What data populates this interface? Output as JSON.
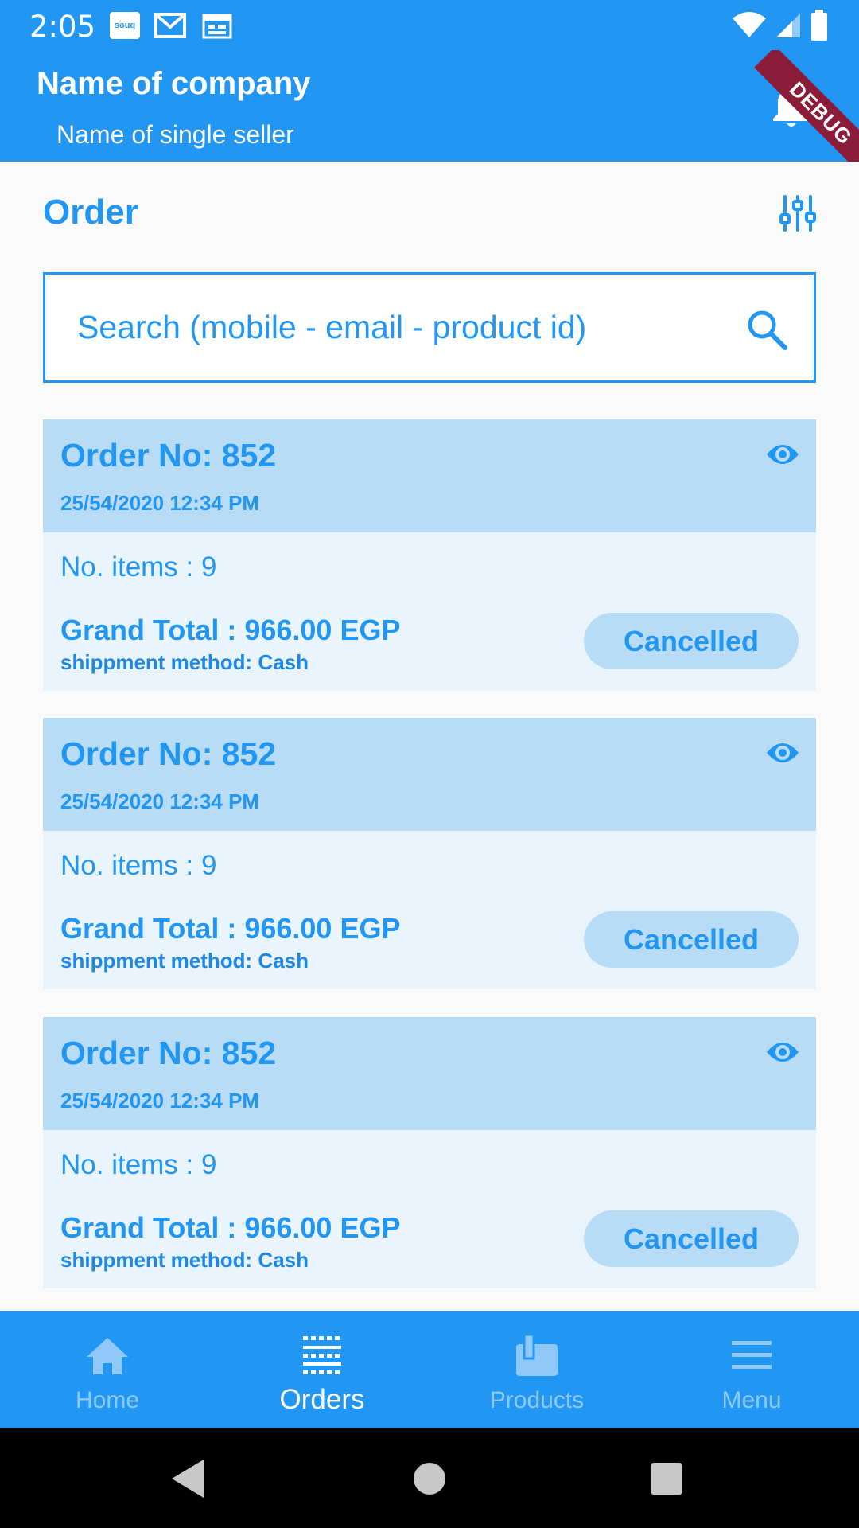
{
  "status_bar": {
    "time": "2:05",
    "notification_icons": [
      "souq-icon",
      "gmail-icon",
      "calendar-icon"
    ],
    "souq_label": "souq",
    "right_icons": [
      "wifi-icon",
      "signal-icon",
      "battery-icon"
    ]
  },
  "app_bar": {
    "company": "Name of company",
    "seller": "Name of single seller",
    "debug_banner": "DEBUG"
  },
  "section": {
    "title": "Order"
  },
  "search": {
    "placeholder": "Search (mobile - email - product id)"
  },
  "orders": [
    {
      "order_no": "Order No: 852",
      "date": "25/54/2020 12:34 PM",
      "items": "No. items : 9",
      "grand_total": "Grand Total : 966.00 EGP",
      "shipment": "shippment method: Cash",
      "status": "Cancelled"
    },
    {
      "order_no": "Order No: 852",
      "date": "25/54/2020 12:34 PM",
      "items": "No. items : 9",
      "grand_total": "Grand Total : 966.00 EGP",
      "shipment": "shippment method: Cash",
      "status": "Cancelled"
    },
    {
      "order_no": "Order No: 852",
      "date": "25/54/2020 12:34 PM",
      "items": "No. items : 9",
      "grand_total": "Grand Total : 966.00 EGP",
      "shipment": "shippment method: Cash",
      "status": "Cancelled"
    }
  ],
  "bottom_nav": {
    "items": [
      {
        "label": "Home",
        "icon": "home-icon",
        "active": false
      },
      {
        "label": "Orders",
        "icon": "orders-icon",
        "active": true
      },
      {
        "label": "Products",
        "icon": "products-icon",
        "active": false
      },
      {
        "label": "Menu",
        "icon": "menu-icon",
        "active": false
      }
    ]
  },
  "colors": {
    "primary": "#2196f3",
    "card_header": "#b9dcf6",
    "card_body": "#eaf4fc",
    "inactive_nav": "#90c9f7",
    "debug_banner": "#8b1c3a"
  }
}
